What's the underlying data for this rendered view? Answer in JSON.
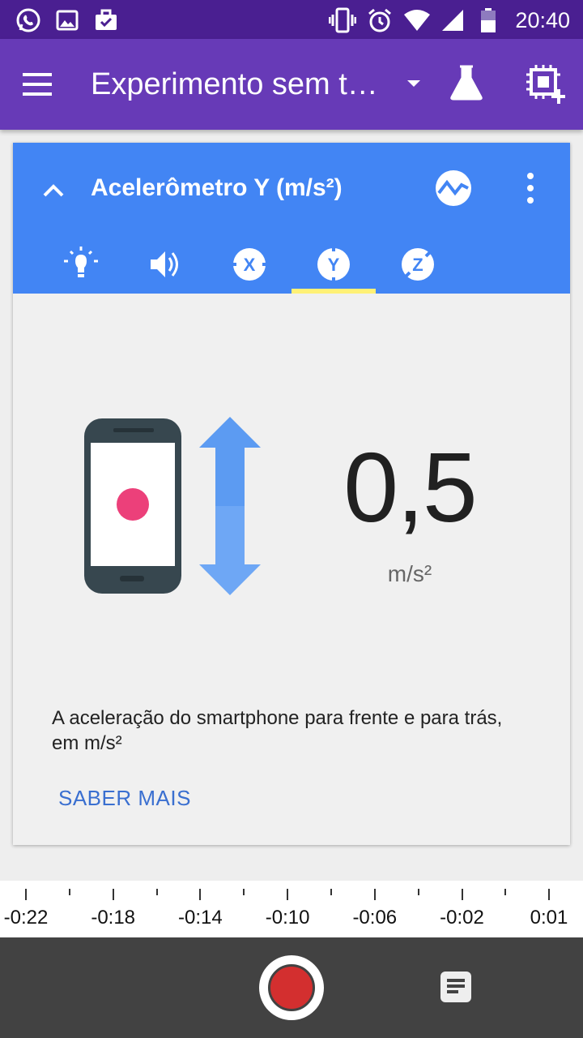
{
  "status_bar": {
    "time": "20:40",
    "icons": [
      "whatsapp-icon",
      "image-icon",
      "briefcase-check-icon",
      "vibrate-icon",
      "alarm-icon",
      "wifi-icon",
      "signal-icon",
      "battery-icon"
    ]
  },
  "app_bar": {
    "title": "Experimento sem t…",
    "icons": [
      "menu-icon",
      "dropdown-arrow-icon",
      "flask-icon",
      "add-sensor-icon"
    ]
  },
  "sensor_card": {
    "title": "Acelerômetro Y (m/s²)",
    "tabs": [
      {
        "name": "light",
        "label": ""
      },
      {
        "name": "sound",
        "label": ""
      },
      {
        "name": "accel-x",
        "label": "X"
      },
      {
        "name": "accel-y",
        "label": "Y",
        "selected": true
      },
      {
        "name": "accel-z",
        "label": "Z"
      }
    ],
    "value": "0,5",
    "unit": "m/s²",
    "description": "A aceleração do smartphone para frente e para trás, em m/s²",
    "learn_more": "SABER MAIS"
  },
  "timeline": {
    "labels": [
      "-0:22",
      "-0:18",
      "-0:14",
      "-0:10",
      "-0:06",
      "-0:02",
      "0:01"
    ]
  },
  "colors": {
    "status_bar": "#4a1f91",
    "app_bar": "#673ab7",
    "card_header": "#4285f4",
    "tab_indicator": "#fff176",
    "record": "#d32f2f",
    "link": "#3a6fd0"
  }
}
